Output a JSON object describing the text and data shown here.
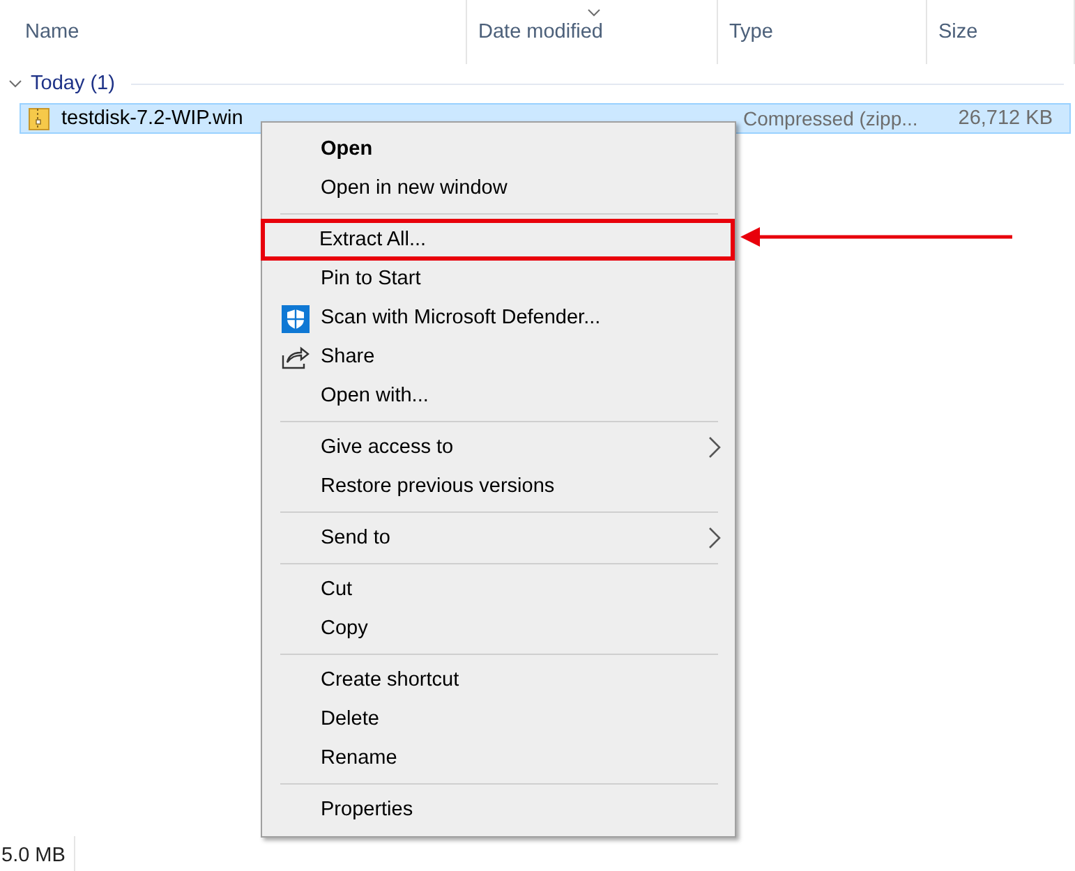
{
  "columns": [
    {
      "label": "Name"
    },
    {
      "label": "Date modified",
      "sorted": true
    },
    {
      "label": "Type"
    },
    {
      "label": "Size"
    }
  ],
  "group": {
    "label": "Today (1)",
    "expanded": true
  },
  "file": {
    "name": "testdisk-7.2-WIP.win",
    "type": "Compressed (zipp...",
    "size": "26,712 KB",
    "selected": true
  },
  "context_menu": {
    "items": [
      {
        "kind": "item",
        "label": "Open",
        "default": true
      },
      {
        "kind": "item",
        "label": "Open in new window"
      },
      {
        "kind": "separator"
      },
      {
        "kind": "item",
        "label": "Extract All...",
        "highlighted": true
      },
      {
        "kind": "item",
        "label": "Pin to Start"
      },
      {
        "kind": "shield-item",
        "label": "Scan with Microsoft Defender..."
      },
      {
        "kind": "share-item",
        "label": "Share"
      },
      {
        "kind": "item",
        "label": "Open with..."
      },
      {
        "kind": "separator"
      },
      {
        "kind": "submenu",
        "label": "Give access to"
      },
      {
        "kind": "item",
        "label": "Restore previous versions"
      },
      {
        "kind": "separator"
      },
      {
        "kind": "submenu",
        "label": "Send to"
      },
      {
        "kind": "separator"
      },
      {
        "kind": "item",
        "label": "Cut"
      },
      {
        "kind": "item",
        "label": "Copy"
      },
      {
        "kind": "separator"
      },
      {
        "kind": "item",
        "label": "Create shortcut"
      },
      {
        "kind": "item",
        "label": "Delete"
      },
      {
        "kind": "item",
        "label": "Rename"
      },
      {
        "kind": "separator"
      },
      {
        "kind": "item",
        "label": "Properties"
      }
    ]
  },
  "status_bar": {
    "text": "5.0 MB"
  }
}
